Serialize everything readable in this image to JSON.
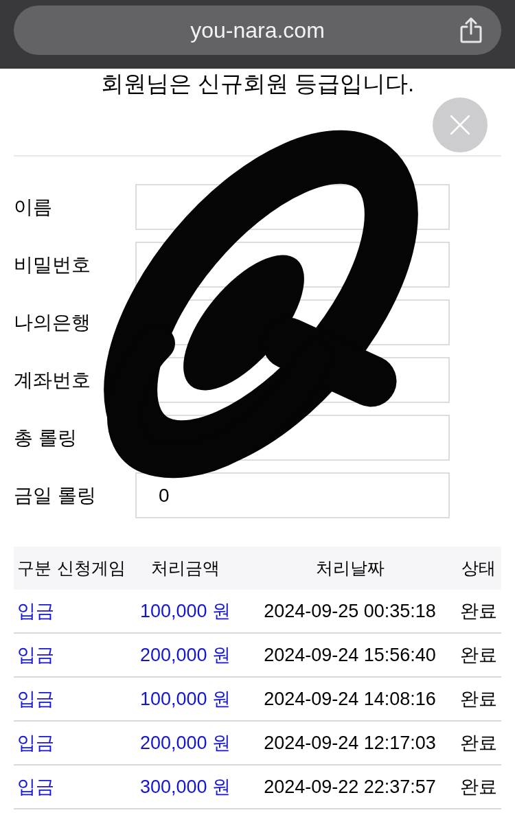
{
  "browser_bar": {
    "url": "you-nara.com"
  },
  "heading": "회원님은 신규회원 등급입니다.",
  "form": {
    "fields": [
      {
        "label": "이름"
      },
      {
        "label": "비밀번호"
      },
      {
        "label": "나의은행"
      },
      {
        "label": "계좌번호"
      },
      {
        "label": "총 롤링"
      },
      {
        "label": "금일 롤링",
        "value": "0"
      }
    ]
  },
  "table": {
    "columns": [
      "구분",
      "신청게임",
      "처리금액",
      "처리날짜",
      "상태"
    ],
    "rows": [
      {
        "category": "입금",
        "amount": "100,000 원",
        "date": "2024-09-25 00:35:18",
        "status": "완료"
      },
      {
        "category": "입금",
        "amount": "200,000 원",
        "date": "2024-09-24 15:56:40",
        "status": "완료"
      },
      {
        "category": "입금",
        "amount": "100,000 원",
        "date": "2024-09-24 14:08:16",
        "status": "완료"
      },
      {
        "category": "입금",
        "amount": "200,000 원",
        "date": "2024-09-24 12:17:03",
        "status": "완료"
      },
      {
        "category": "입금",
        "amount": "300,000 원",
        "date": "2024-09-22 22:37:57",
        "status": "완료"
      }
    ]
  }
}
